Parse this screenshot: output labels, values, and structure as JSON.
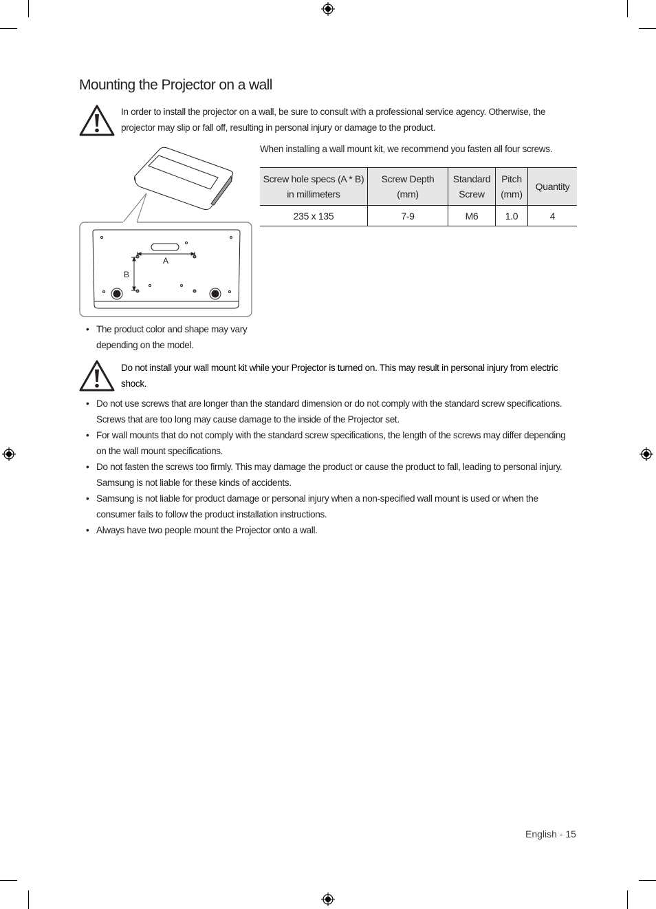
{
  "page": {
    "title": "Mounting the Projector on a wall",
    "warning_1": "In order to install the projector on a wall, be sure to consult with a professional service agency. Otherwise, the projector may slip or fall off, resulting in personal injury or damage to the product.",
    "intro": "When installing a wall mount kit, we recommend you fasten all four screws.",
    "diagram_labels": {
      "a": "A",
      "b": "B"
    },
    "note": "The product color and shape may vary depending on the model.",
    "warning_2": "Do not install your wall mount kit while your Projector is turned on. This may result in personal injury from electric shock.",
    "bullets": [
      "Do not use screws that are longer than the standard dimension or do not comply with the standard screw specifications. Screws that are too long may cause damage to the inside of the Projector set.",
      "For wall mounts that do not comply with the standard screw specifications, the length of the screws may differ depending on the wall mount specifications.",
      "Do not fasten the screws too firmly. This may damage the product or cause the product to fall, leading to personal injury. Samsung is not liable for these kinds of accidents.",
      "Samsung is not liable for product damage or personal injury when a non-specified wall mount is used or when the consumer fails to follow the product installation instructions.",
      "Always have two people mount the Projector onto a wall."
    ],
    "footer": "English - 15"
  },
  "table": {
    "headers": [
      "Screw hole specs (A * B) in millimeters",
      "Screw Depth (mm)",
      "Standard Screw",
      "Pitch (mm)",
      "Quantity"
    ],
    "rows": [
      [
        "235 x 135",
        "7-9",
        "M6",
        "1.0",
        "4"
      ]
    ]
  },
  "icons": {
    "warning": "warning-triangle-icon",
    "registration": "registration-mark-icon"
  },
  "colors": {
    "text": "#231f20",
    "table_header_bg": "#e6e6e6"
  }
}
